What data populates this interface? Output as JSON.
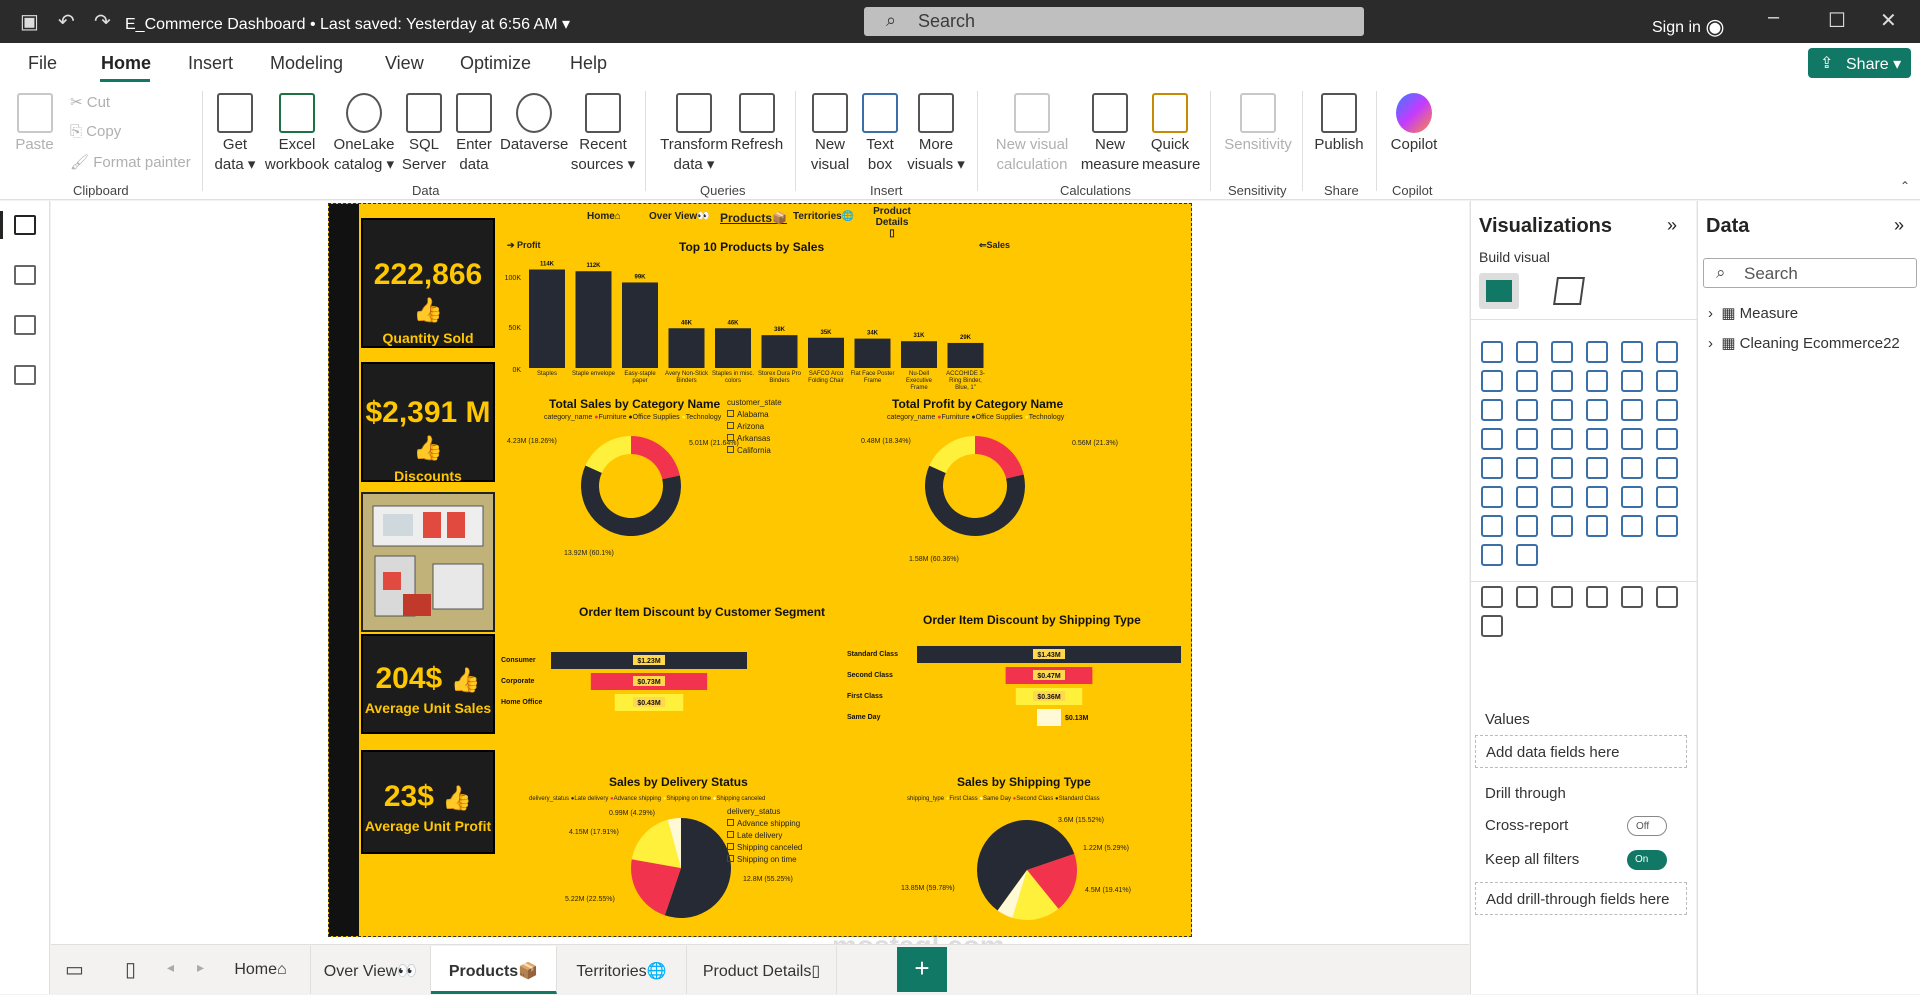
{
  "titlebar": {
    "doc_title": "E_Commerce Dashboard",
    "saved": "Last saved: Yesterday at 6:56 AM",
    "search_placeholder": "Search",
    "signin": "Sign in"
  },
  "menu": {
    "items": [
      "File",
      "Home",
      "Insert",
      "Modeling",
      "View",
      "Optimize",
      "Help"
    ],
    "active": "Home",
    "share": "Share"
  },
  "ribbon": {
    "clipboard": {
      "paste": "Paste",
      "cut": "Cut",
      "copy": "Copy",
      "format_painter": "Format painter",
      "group": "Clipboard"
    },
    "data": {
      "get_data": "Get data",
      "excel": "Excel workbook",
      "onelake": "OneLake catalog",
      "sql": "SQL Server",
      "enter": "Enter data",
      "dataverse": "Dataverse",
      "recent": "Recent sources",
      "group": "Data"
    },
    "queries": {
      "transform": "Transform data",
      "refresh": "Refresh",
      "group": "Queries"
    },
    "insert": {
      "new_visual": "New visual",
      "text_box": "Text box",
      "more_visuals": "More visuals",
      "group": "Insert"
    },
    "calculations": {
      "new_visual_calc": "New visual calculation",
      "new_measure": "New measure",
      "quick_measure": "Quick measure",
      "group": "Calculations"
    },
    "sensitivity": {
      "label": "Sensitivity",
      "group": "Sensitivity"
    },
    "share": {
      "publish": "Publish",
      "group": "Share"
    },
    "copilot": {
      "label": "Copilot",
      "group": "Copilot"
    }
  },
  "report": {
    "nav": {
      "home": "Home",
      "overview": "Over View",
      "products": "Products",
      "territories": "Territories",
      "product_details": "Product Details"
    },
    "kpis": [
      {
        "value": "222,866",
        "label": "Quantity Sold"
      },
      {
        "value": "$2,391 M",
        "label": "Discounts"
      },
      {
        "value": "204$",
        "label": "Average Unit Sales"
      },
      {
        "value": "23$",
        "label": "Average Unit Profit"
      }
    ],
    "top10": {
      "title": "Top 10 Products by Sales",
      "profit_btn": "Profit",
      "sales_btn": "Sales"
    },
    "donut1": {
      "title": "Total Sales by Category Name",
      "legend_title": "category_name",
      "labels": [
        "4.23M (18.26%)",
        "5.01M (21.64%)",
        "13.92M (60.1%)"
      ]
    },
    "donut2": {
      "title": "Total Profit by Category Name",
      "legend_title": "category_name",
      "labels": [
        "0.48M (18.34%)",
        "0.56M (21.3%)",
        "1.58M (60.36%)"
      ]
    },
    "categories": [
      "Furniture",
      "Office Supplies",
      "Technology"
    ],
    "slicer": {
      "title": "customer_state",
      "items": [
        "Alabama",
        "Arizona",
        "Arkansas",
        "California"
      ]
    },
    "funnel1": {
      "title": "Order Item Discount by Customer Segment"
    },
    "funnel2": {
      "title": "Order Item Discount by Shipping Type"
    },
    "pie1": {
      "title": "Sales by Delivery Status",
      "legend_title": "delivery_status",
      "legend": [
        "Late delivery",
        "Advance shipping",
        "Shipping on time",
        "Shipping canceled"
      ],
      "labels": [
        "0.99M (4.29%)",
        "4.15M (17.91%)",
        "12.8M (55.25%)",
        "5.22M (22.55%)"
      ]
    },
    "slicer2": {
      "title": "delivery_status",
      "items": [
        "Advance shipping",
        "Late delivery",
        "Shipping canceled",
        "Shipping on time"
      ]
    },
    "pie2": {
      "title": "Sales by Shipping Type",
      "legend_title": "shipping_type",
      "legend": [
        "First Class",
        "Same Day",
        "Second Class",
        "Standard Class"
      ],
      "labels": [
        "3.6M (15.52%)",
        "1.22M (5.29%)",
        "4.5M (19.41%)",
        "13.85M (59.78%)"
      ]
    }
  },
  "chart_data": [
    {
      "type": "bar",
      "title": "Top 10 Products by Sales",
      "categories": [
        "Staples",
        "Staple envelope",
        "Easy-staple paper",
        "Avery Non-Stick Binders",
        "Staples in misc. colors",
        "Storex Dura Pro Binders",
        "SAFCO Arco Folding Chair",
        "Flat Face Poster Frame",
        "Nu-Dell Executive Frame",
        "ACCOHIDE 3-Ring Binder, Blue, 1\""
      ],
      "values": [
        114,
        112,
        99,
        46,
        46,
        38,
        35,
        34,
        31,
        29
      ],
      "data_labels": [
        "114K",
        "112K",
        "99K",
        "46K",
        "46K",
        "38K",
        "35K",
        "34K",
        "31K",
        "29K"
      ],
      "yticks": [
        "100K",
        "50K",
        "0K"
      ],
      "ylim": [
        0,
        125
      ]
    },
    {
      "type": "pie",
      "title": "Total Sales by Category Name",
      "categories": [
        "Furniture",
        "Office Supplies",
        "Technology"
      ],
      "values": [
        21.64,
        60.1,
        18.26
      ]
    },
    {
      "type": "pie",
      "title": "Total Profit by Category Name",
      "categories": [
        "Furniture",
        "Office Supplies",
        "Technology"
      ],
      "values": [
        21.3,
        60.36,
        18.34
      ]
    },
    {
      "type": "bar",
      "title": "Order Item Discount by Customer Segment",
      "categories": [
        "Consumer",
        "Corporate",
        "Home Office"
      ],
      "values": [
        1.23,
        0.73,
        0.43
      ],
      "data_labels": [
        "$1.23M",
        "$0.73M",
        "$0.43M"
      ]
    },
    {
      "type": "bar",
      "title": "Order Item Discount by Shipping Type",
      "categories": [
        "Standard Class",
        "Second Class",
        "First Class",
        "Same Day"
      ],
      "values": [
        1.43,
        0.47,
        0.36,
        0.13
      ],
      "data_labels": [
        "$1.43M",
        "$0.47M",
        "$0.36M",
        "$0.13M"
      ]
    },
    {
      "type": "pie",
      "title": "Sales by Delivery Status",
      "categories": [
        "Late delivery",
        "Advance shipping",
        "Shipping on time",
        "Shipping canceled"
      ],
      "values": [
        55.25,
        22.55,
        17.91,
        4.29
      ]
    },
    {
      "type": "pie",
      "title": "Sales by Shipping Type",
      "categories": [
        "Standard Class",
        "Second Class",
        "First Class",
        "Same Day"
      ],
      "values": [
        59.78,
        19.41,
        15.52,
        5.29
      ]
    }
  ],
  "tabs": [
    "Home",
    "Over View",
    "Products",
    "Territories",
    "Product Details"
  ],
  "active_tab": "Products",
  "viz_pane": {
    "title": "Visualizations",
    "build": "Build visual",
    "values": "Values",
    "add_fields": "Add data fields here",
    "drill": "Drill through",
    "cross_report": "Cross-report",
    "cross_state": "Off",
    "keep_filters": "Keep all filters",
    "keep_state": "On",
    "add_drill": "Add drill-through fields here"
  },
  "data_pane": {
    "title": "Data",
    "search": "Search",
    "items": [
      "Measure",
      "Cleaning Ecommerce22"
    ]
  },
  "colors": {
    "accent": "#117865",
    "report_bg": "#ffc700",
    "dark": "#252a34",
    "red": "#f2334d",
    "yellow": "#fff03c",
    "light": "#fff9d6"
  },
  "watermark": "mostaql.com"
}
